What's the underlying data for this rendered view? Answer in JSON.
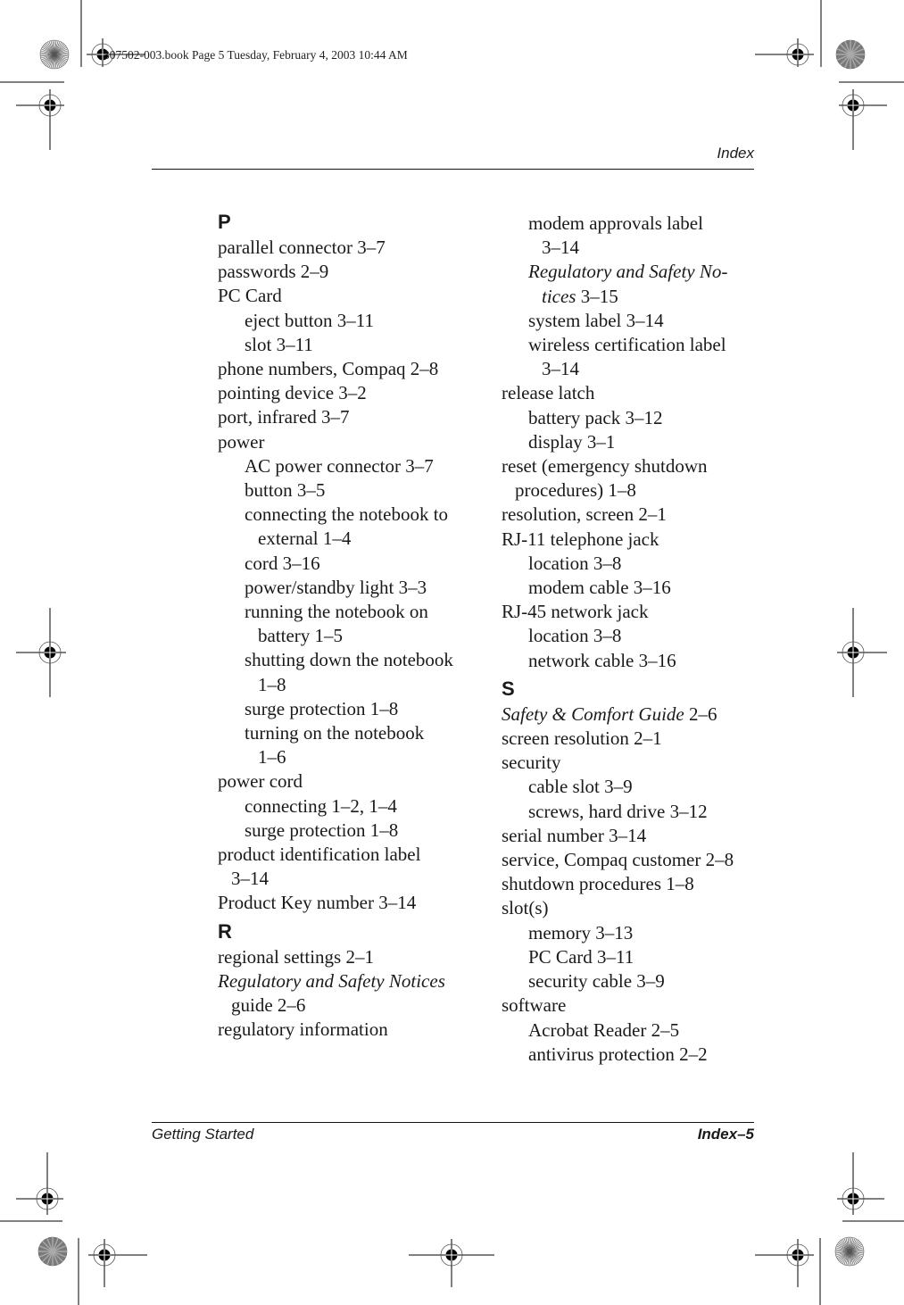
{
  "slug": "307502-003.book  Page 5  Tuesday, February 4, 2003  10:44 AM",
  "header": {
    "running_title": "Index"
  },
  "footer": {
    "book_title": "Getting Started",
    "page_number": "Index–5"
  },
  "columns": {
    "left": [
      {
        "type": "letter",
        "text": "P"
      },
      {
        "type": "entry",
        "level": 0,
        "lines": [
          "parallel connector 3–7"
        ]
      },
      {
        "type": "entry",
        "level": 0,
        "lines": [
          "passwords 2–9"
        ]
      },
      {
        "type": "entry",
        "level": 0,
        "lines": [
          "PC Card"
        ]
      },
      {
        "type": "entry",
        "level": 1,
        "lines": [
          "eject button 3–11"
        ]
      },
      {
        "type": "entry",
        "level": 1,
        "lines": [
          "slot 3–11"
        ]
      },
      {
        "type": "entry",
        "level": 0,
        "lines": [
          "phone numbers, Compaq 2–8"
        ]
      },
      {
        "type": "entry",
        "level": 0,
        "lines": [
          "pointing device 3–2"
        ]
      },
      {
        "type": "entry",
        "level": 0,
        "lines": [
          "port, infrared 3–7"
        ]
      },
      {
        "type": "entry",
        "level": 0,
        "lines": [
          "power"
        ]
      },
      {
        "type": "entry",
        "level": 1,
        "lines": [
          "AC power connector 3–7"
        ]
      },
      {
        "type": "entry",
        "level": 1,
        "lines": [
          "button 3–5"
        ]
      },
      {
        "type": "entry",
        "level": 1,
        "lines": [
          "connecting the notebook to",
          "external 1–4"
        ]
      },
      {
        "type": "entry",
        "level": 1,
        "lines": [
          "cord 3–16"
        ]
      },
      {
        "type": "entry",
        "level": 1,
        "lines": [
          "power/standby light 3–3"
        ]
      },
      {
        "type": "entry",
        "level": 1,
        "lines": [
          "running the notebook on",
          "battery 1–5"
        ]
      },
      {
        "type": "entry",
        "level": 1,
        "lines": [
          "shutting down the notebook",
          "1–8"
        ]
      },
      {
        "type": "entry",
        "level": 1,
        "lines": [
          "surge protection 1–8"
        ]
      },
      {
        "type": "entry",
        "level": 1,
        "lines": [
          "turning on the notebook",
          "1–6"
        ]
      },
      {
        "type": "entry",
        "level": 0,
        "lines": [
          "power cord"
        ]
      },
      {
        "type": "entry",
        "level": 1,
        "lines": [
          "connecting 1–2, 1–4"
        ]
      },
      {
        "type": "entry",
        "level": 1,
        "lines": [
          "surge protection 1–8"
        ]
      },
      {
        "type": "entry",
        "level": 0,
        "lines": [
          "product identification label",
          "3–14"
        ]
      },
      {
        "type": "entry",
        "level": 0,
        "lines": [
          "Product Key number 3–14"
        ]
      },
      {
        "type": "letter",
        "text": "R"
      },
      {
        "type": "entry",
        "level": 0,
        "lines": [
          "regional settings 2–1"
        ]
      },
      {
        "type": "entry",
        "level": 0,
        "italic": "Regulatory and Safety Notices",
        "lines": [
          "",
          "guide 2–6"
        ]
      },
      {
        "type": "entry",
        "level": 0,
        "lines": [
          "regulatory information"
        ]
      }
    ],
    "right": [
      {
        "type": "entry",
        "level": 1,
        "lines": [
          "modem approvals label",
          "3–14"
        ]
      },
      {
        "type": "entry",
        "level": 1,
        "italic": "Regulatory and Safety No-",
        "italic2": "tices",
        "lines": [
          "",
          " 3–15"
        ]
      },
      {
        "type": "entry",
        "level": 1,
        "lines": [
          "system label 3–14"
        ]
      },
      {
        "type": "entry",
        "level": 1,
        "lines": [
          "wireless certification label",
          "3–14"
        ]
      },
      {
        "type": "entry",
        "level": 0,
        "lines": [
          "release latch"
        ]
      },
      {
        "type": "entry",
        "level": 1,
        "lines": [
          "battery pack 3–12"
        ]
      },
      {
        "type": "entry",
        "level": 1,
        "lines": [
          "display 3–1"
        ]
      },
      {
        "type": "entry",
        "level": 0,
        "lines": [
          "reset (emergency shutdown",
          "procedures) 1–8"
        ]
      },
      {
        "type": "entry",
        "level": 0,
        "lines": [
          "resolution, screen 2–1"
        ]
      },
      {
        "type": "entry",
        "level": 0,
        "lines": [
          "RJ-11 telephone jack"
        ]
      },
      {
        "type": "entry",
        "level": 1,
        "lines": [
          "location 3–8"
        ]
      },
      {
        "type": "entry",
        "level": 1,
        "lines": [
          "modem cable 3–16"
        ]
      },
      {
        "type": "entry",
        "level": 0,
        "lines": [
          "RJ-45 network jack"
        ]
      },
      {
        "type": "entry",
        "level": 1,
        "lines": [
          "location 3–8"
        ]
      },
      {
        "type": "entry",
        "level": 1,
        "lines": [
          "network cable 3–16"
        ]
      },
      {
        "type": "letter",
        "text": "S"
      },
      {
        "type": "entry",
        "level": 0,
        "italic": "Safety & Comfort Guide",
        "lines": [
          " 2–6"
        ]
      },
      {
        "type": "entry",
        "level": 0,
        "lines": [
          "screen resolution 2–1"
        ]
      },
      {
        "type": "entry",
        "level": 0,
        "lines": [
          "security"
        ]
      },
      {
        "type": "entry",
        "level": 1,
        "lines": [
          "cable slot 3–9"
        ]
      },
      {
        "type": "entry",
        "level": 1,
        "lines": [
          "screws, hard drive 3–12"
        ]
      },
      {
        "type": "entry",
        "level": 0,
        "lines": [
          "serial number 3–14"
        ]
      },
      {
        "type": "entry",
        "level": 0,
        "lines": [
          "service, Compaq customer 2–8"
        ]
      },
      {
        "type": "entry",
        "level": 0,
        "lines": [
          "shutdown procedures 1–8"
        ]
      },
      {
        "type": "entry",
        "level": 0,
        "lines": [
          "slot(s)"
        ]
      },
      {
        "type": "entry",
        "level": 1,
        "lines": [
          "memory 3–13"
        ]
      },
      {
        "type": "entry",
        "level": 1,
        "lines": [
          "PC Card 3–11"
        ]
      },
      {
        "type": "entry",
        "level": 1,
        "lines": [
          "security cable 3–9"
        ]
      },
      {
        "type": "entry",
        "level": 0,
        "lines": [
          "software"
        ]
      },
      {
        "type": "entry",
        "level": 1,
        "lines": [
          "Acrobat Reader 2–5"
        ]
      },
      {
        "type": "entry",
        "level": 1,
        "lines": [
          "antivirus protection 2–2"
        ]
      }
    ]
  }
}
